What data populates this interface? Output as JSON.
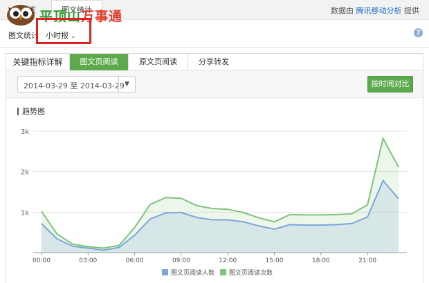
{
  "header": {
    "tabs": [
      {
        "label": "群发"
      },
      {
        "label": "图文统计"
      }
    ],
    "provider_prefix": "数据由",
    "provider_link": "腾讯移动分析",
    "provider_suffix": "提供",
    "brand_green": "平顶山",
    "brand_red": "事通",
    "brand_mid": "万"
  },
  "subbar": {
    "article_stats": "图文统计",
    "hourly": "小时报",
    "help": "?"
  },
  "tabs": [
    {
      "label": "关键指标详解",
      "active": false
    },
    {
      "label": "图文页阅读",
      "active": true
    },
    {
      "label": "原文页阅读",
      "active": false
    },
    {
      "label": "分享转发",
      "active": false
    }
  ],
  "toolbar": {
    "date_range": "2014-03-29 至 2014-03-29",
    "compare_button": "按时间对比"
  },
  "chart_title": "趋势图",
  "colors": {
    "accent": "#5daa4c",
    "series_readers": "#7aa6d8",
    "series_reads": "#7fc47a"
  },
  "chart_data": {
    "type": "area",
    "x": [
      "00:00",
      "01:00",
      "02:00",
      "03:00",
      "04:00",
      "05:00",
      "06:00",
      "07:00",
      "08:00",
      "09:00",
      "10:00",
      "11:00",
      "12:00",
      "13:00",
      "14:00",
      "15:00",
      "16:00",
      "17:00",
      "18:00",
      "19:00",
      "20:00",
      "21:00",
      "22:00",
      "23:00"
    ],
    "x_tick_labels": [
      "00:00",
      "03:00",
      "06:00",
      "09:00",
      "12:00",
      "15:00",
      "18:00",
      "21:00"
    ],
    "y_tick_labels": [
      "1k",
      "2k",
      "3k"
    ],
    "ylim": [
      0,
      3000
    ],
    "grid": true,
    "legend_position": "bottom",
    "series": [
      {
        "name": "图文页阅读人数",
        "values": [
          720,
          340,
          160,
          110,
          60,
          130,
          430,
          830,
          980,
          990,
          870,
          810,
          810,
          760,
          660,
          580,
          690,
          680,
          680,
          690,
          720,
          880,
          1780,
          1330
        ]
      },
      {
        "name": "图文页阅读次数",
        "values": [
          1020,
          460,
          210,
          150,
          110,
          180,
          620,
          1190,
          1360,
          1340,
          1160,
          1090,
          1070,
          990,
          860,
          760,
          940,
          930,
          930,
          940,
          960,
          1180,
          2820,
          2110
        ]
      }
    ]
  }
}
